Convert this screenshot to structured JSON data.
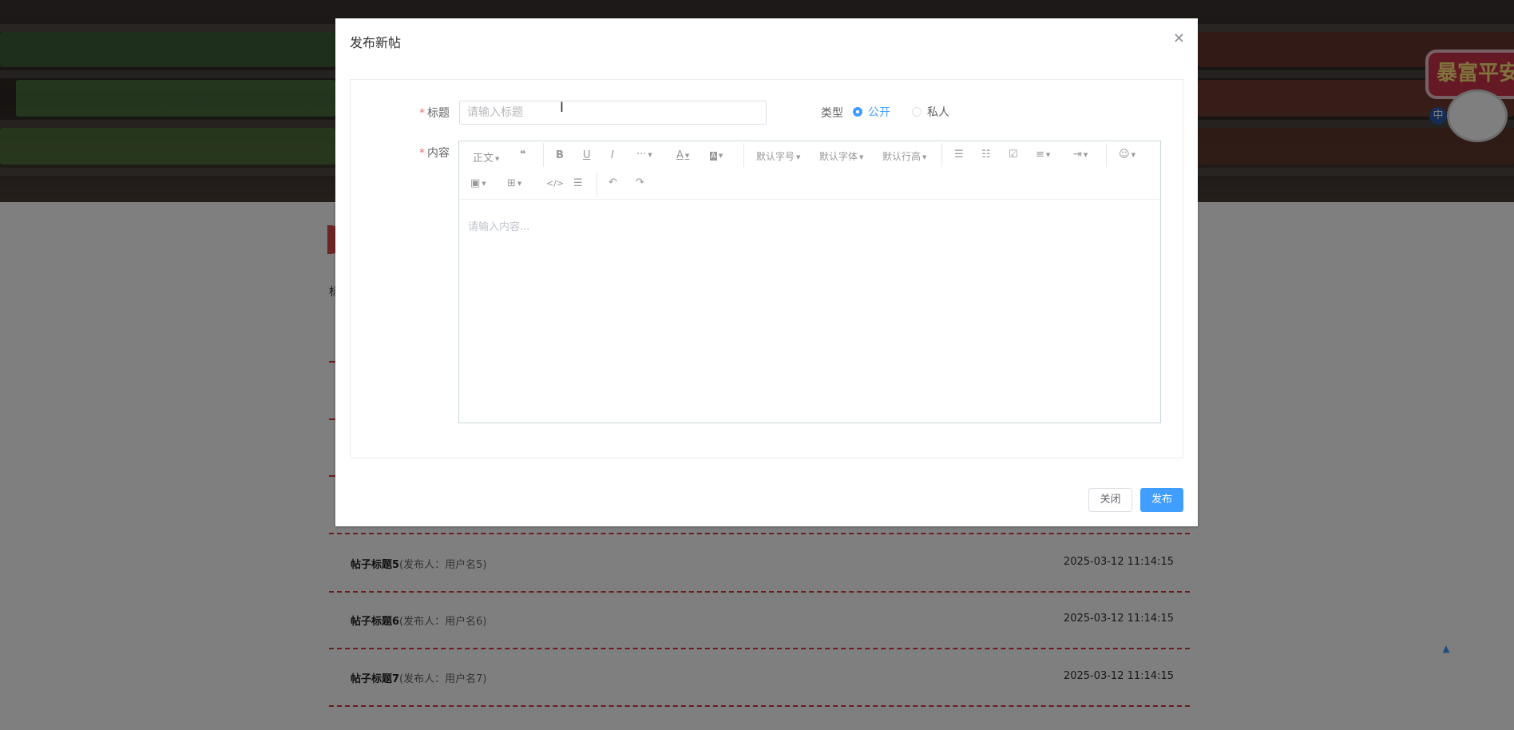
{
  "background": {
    "sign_text": "暴富平安",
    "sign_mark": "中",
    "side_char": "标",
    "posts": [
      {
        "title": "帖子标题5",
        "author": "(发布人：用户名5)",
        "time": "2025-03-12 11:14:15"
      },
      {
        "title": "帖子标题6",
        "author": "(发布人：用户名6)",
        "time": "2025-03-12 11:14:15"
      },
      {
        "title": "帖子标题7",
        "author": "(发布人：用户名7)",
        "time": "2025-03-12 11:14:15"
      }
    ],
    "back_to_top_icon": "caret-up-icon",
    "accent_color": "#d93b3b"
  },
  "dialog": {
    "title": "发布新帖",
    "close_icon": "close-icon",
    "form": {
      "title_label": "标题",
      "title_placeholder": "请输入标题",
      "title_value": "",
      "type_label": "类型",
      "type_options": [
        "公开",
        "私人"
      ],
      "type_selected": "公开",
      "content_label": "内容",
      "content_placeholder": "请输入内容..."
    },
    "toolbar": {
      "paragraph": "正文",
      "font_size": "默认字号",
      "font_family": "默认字体",
      "line_height": "默认行高",
      "icons": [
        "blockquote-icon",
        "bold-icon",
        "underline-icon",
        "italic-icon",
        "more-icon",
        "font-color-icon",
        "background-color-icon",
        "bulleted-list-icon",
        "numbered-list-icon",
        "todo-icon",
        "align-icon",
        "indent-icon",
        "emoji-icon",
        "image-icon",
        "table-icon",
        "code-icon",
        "divider-icon",
        "undo-icon",
        "redo-icon"
      ]
    },
    "footer": {
      "close_label": "关闭",
      "publish_label": "发布"
    },
    "primary_color": "#409eff"
  }
}
